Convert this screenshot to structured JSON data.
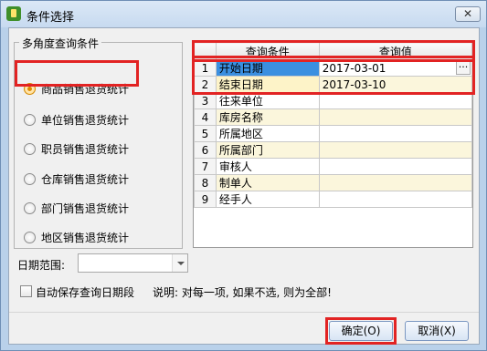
{
  "window": {
    "title": "条件选择",
    "close_label": "✕"
  },
  "group": {
    "title": "多角度查询条件",
    "options": [
      {
        "label": "商品销售退货统计",
        "checked": true
      },
      {
        "label": "单位销售退货统计",
        "checked": false
      },
      {
        "label": "职员销售退货统计",
        "checked": false
      },
      {
        "label": "仓库销售退货统计",
        "checked": false
      },
      {
        "label": "部门销售退货统计",
        "checked": false
      },
      {
        "label": "地区销售退货统计",
        "checked": false
      }
    ]
  },
  "grid": {
    "headers": {
      "condition": "查询条件",
      "value": "查询值"
    },
    "rows": [
      {
        "num": "1",
        "condition": "开始日期",
        "value": "2017-03-01"
      },
      {
        "num": "2",
        "condition": "结束日期",
        "value": "2017-03-10"
      },
      {
        "num": "3",
        "condition": "往来单位",
        "value": ""
      },
      {
        "num": "4",
        "condition": "库房名称",
        "value": ""
      },
      {
        "num": "5",
        "condition": "所属地区",
        "value": ""
      },
      {
        "num": "6",
        "condition": "所属部门",
        "value": ""
      },
      {
        "num": "7",
        "condition": "审核人",
        "value": ""
      },
      {
        "num": "8",
        "condition": "制单人",
        "value": ""
      },
      {
        "num": "9",
        "condition": "经手人",
        "value": ""
      }
    ],
    "ellipsis": "···"
  },
  "date_range": {
    "label": "日期范围:",
    "value": ""
  },
  "autosave": {
    "label": "自动保存查询日期段",
    "checked": false
  },
  "note": "说明: 对每一项, 如果不选, 则为全部!",
  "buttons": {
    "ok": "确定(O)",
    "cancel": "取消(X)"
  },
  "colors": {
    "highlight": "#e22323",
    "selection": "#3b8fe0",
    "titlebar": "#c7daf0"
  }
}
